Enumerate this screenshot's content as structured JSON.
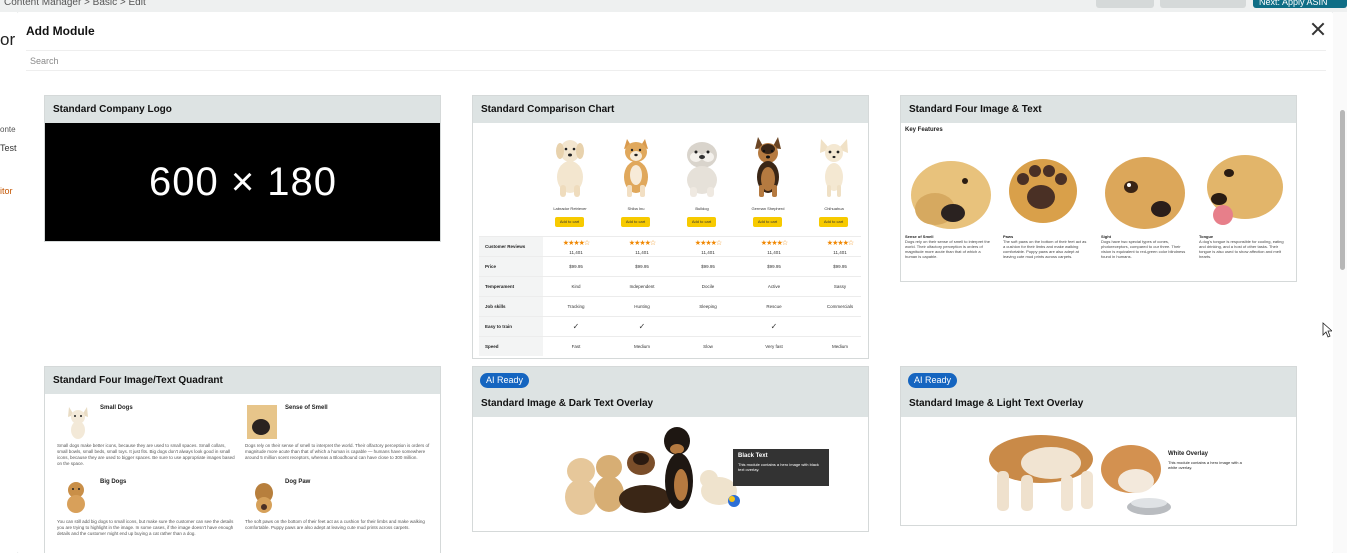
{
  "modal": {
    "title": "Add Module",
    "search_placeholder": "Search"
  },
  "background": {
    "breadcrumb": "Content Manager  >  Basic  >  Edit",
    "primary_button_label": "Next: Apply ASIN",
    "left_fragments": [
      "or",
      "onte",
      "Test",
      "itor"
    ]
  },
  "cards": {
    "company_logo": {
      "title": "Standard Company Logo",
      "placeholder_text": "600 × 180"
    },
    "comparison_chart": {
      "title": "Standard Comparison Chart",
      "products": [
        {
          "name": "Labrador Retriever",
          "cart": "Add to cart",
          "reviews": "11,401",
          "price": "$99.95",
          "temperament": "Kind",
          "job": "Tracking",
          "easy": "✓",
          "speed": "Fast"
        },
        {
          "name": "Shiba Inu",
          "cart": "Add to cart",
          "reviews": "11,401",
          "price": "$99.95",
          "temperament": "Independent",
          "job": "Hunting",
          "easy": "✓",
          "speed": "Medium"
        },
        {
          "name": "Bulldog",
          "cart": "Add to cart",
          "reviews": "11,401",
          "price": "$99.95",
          "temperament": "Docile",
          "job": "Sleeping",
          "easy": "",
          "speed": "Slow"
        },
        {
          "name": "German Shepherd",
          "cart": "Add to cart",
          "reviews": "11,401",
          "price": "$99.95",
          "temperament": "Active",
          "job": "Rescue",
          "easy": "✓",
          "speed": "Very fast"
        },
        {
          "name": "Chihuahua",
          "cart": "Add to cart",
          "reviews": "11,401",
          "price": "$99.95",
          "temperament": "Sassy",
          "job": "Commercials",
          "easy": "",
          "speed": "Medium"
        }
      ],
      "row_labels": {
        "reviews": "Customer Reviews",
        "price": "Price",
        "temperament": "Temperament",
        "job": "Job skills",
        "easy": "Easy to train",
        "speed": "Speed"
      },
      "stars": "★★★★☆"
    },
    "four_image_text": {
      "title": "Standard Four Image & Text",
      "heading": "Key Features",
      "items": [
        {
          "title": "Sense of Smell",
          "text": "Dogs rely on their sense of smell to interpret the world. Their olfactory perception is orders of magnitude more acute than that of which a human is capable."
        },
        {
          "title": "Paws",
          "text": "The soft paws on the bottom of their feet act as a cushion for their limbs and make walking comfortable. Puppy paws are also adept at leaving cute mud prints across carpets."
        },
        {
          "title": "Sight",
          "text": "Dogs have two special types of cones, photoreceptors, compared to our three. Their vision is equivalent to red-green color blindness found in humans."
        },
        {
          "title": "Tongue",
          "text": "A dog's tongue is responsible for cooling, eating and drinking, and a host of other tasks. Their tongue is also used to show affection and melt hearts."
        }
      ]
    },
    "quadrant": {
      "title": "Standard Four Image/Text Quadrant",
      "items": [
        {
          "title": "Small Dogs",
          "text": "Small dogs make better icons, because they are used to small spaces. Small collars, small bowls, small beds, small toys. It just fits. Big dogs don't always look good in small icons, because they are used to bigger spaces. Be sure to use appropriate images based on the space."
        },
        {
          "title": "Sense of Smell",
          "text": "Dogs rely on their sense of smell to interpret the world. Their olfactory perception is orders of magnitude more acute than that of which a human is capable — humans have somewhere around 5 million scent receptors, whereas a Bloodhound can have close to 300 million."
        },
        {
          "title": "Big Dogs",
          "text": "You can still add big dogs to small icons, but make sure the customer can see the details you are trying to highlight in the image. In some cases, if the image doesn't have enough details and the customer might end up buying a cat rather than a dog."
        },
        {
          "title": "Dog Paw",
          "text": "The soft paws on the bottom of their feet act as a cushion for their limbs and make walking comfortable. Puppy paws are also adept at leaving cute mud prints across carpets."
        }
      ]
    },
    "dark_overlay": {
      "badge": "AI Ready",
      "title": "Standard Image & Dark Text Overlay",
      "overlay_title": "Black Text",
      "overlay_text": "This module contains a hero image with black text overlay."
    },
    "light_overlay": {
      "badge": "AI Ready",
      "title": "Standard Image & Light Text Overlay",
      "overlay_title": "White Overlay",
      "overlay_text": "This module contains a hero image with a white overlay."
    }
  },
  "colors": {
    "card_header": "#dde3e3",
    "ai_badge": "#1565c0",
    "cart_button": "#f7ca00",
    "stars": "#f08804"
  }
}
